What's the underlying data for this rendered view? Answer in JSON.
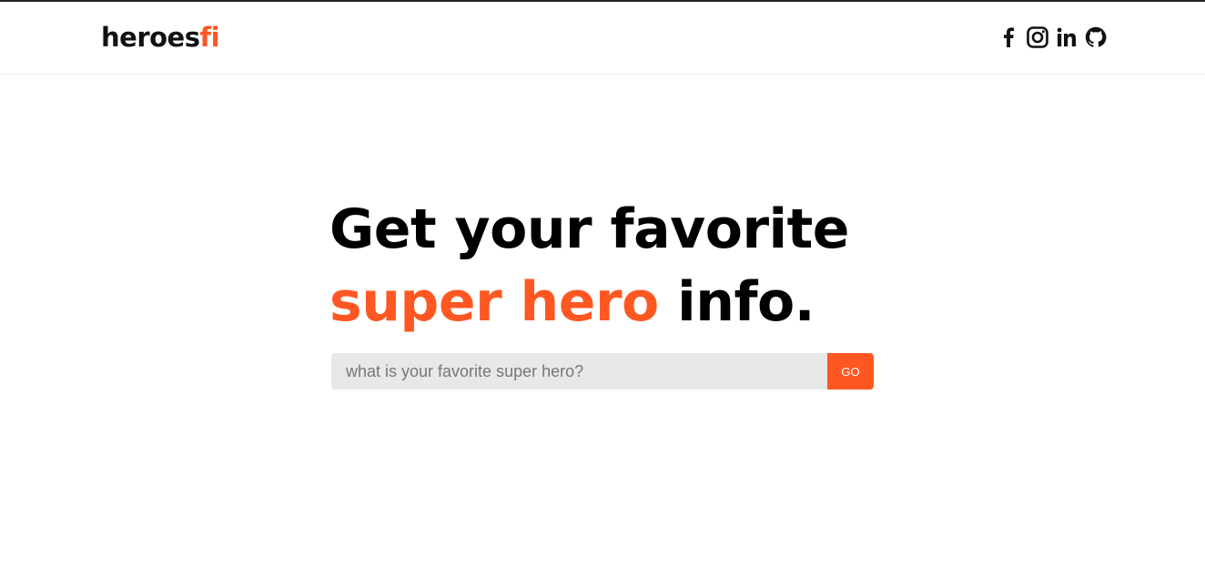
{
  "header": {
    "logo_main": "heroes",
    "logo_accent": "fi",
    "social": [
      {
        "name": "facebook-icon"
      },
      {
        "name": "instagram-icon"
      },
      {
        "name": "linkedin-icon"
      },
      {
        "name": "github-icon"
      }
    ]
  },
  "hero": {
    "line1": "Get your favorite",
    "line2_accent": "super hero",
    "line2_rest": " info."
  },
  "search": {
    "placeholder": "what is your favorite super hero?",
    "value": "",
    "button_label": "GO"
  },
  "colors": {
    "accent": "#ff5722",
    "text": "#000000",
    "input_bg": "#e8e8e8"
  }
}
